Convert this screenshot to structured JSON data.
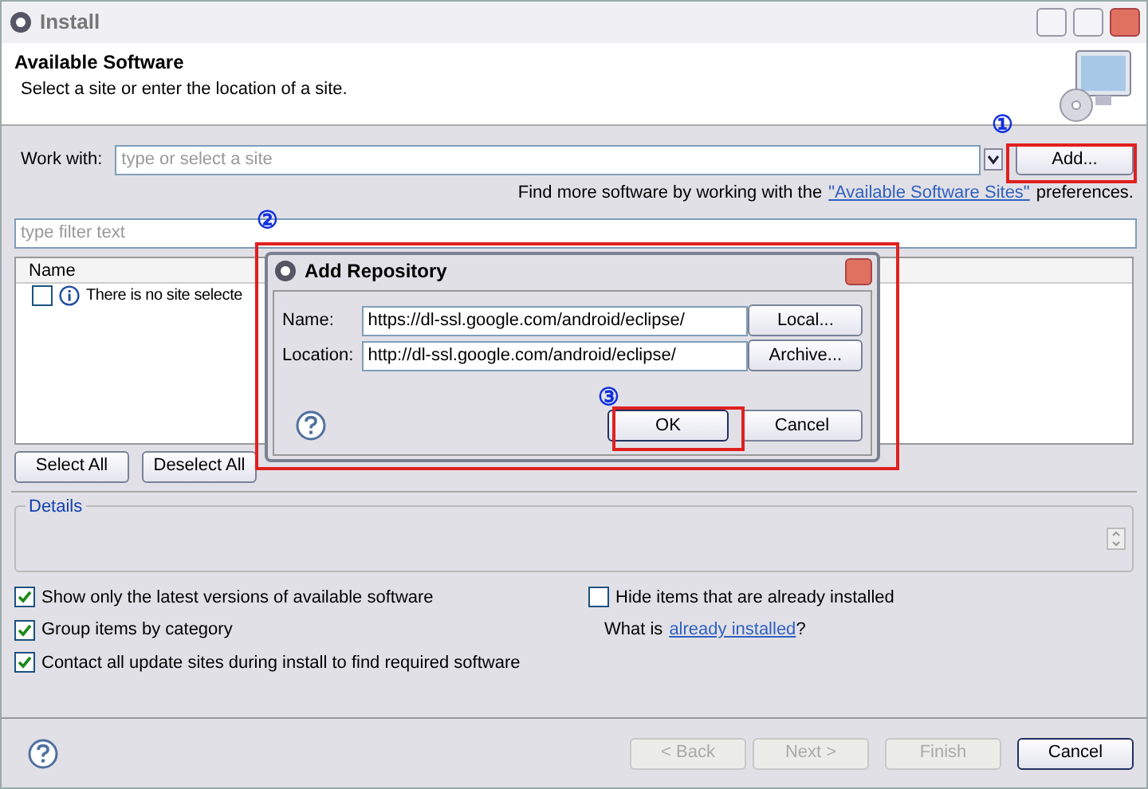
{
  "window": {
    "title": "Install"
  },
  "header": {
    "title": "Available Software",
    "description": "Select a site or enter the location of a site."
  },
  "work_with": {
    "label": "Work with:",
    "placeholder": "type or select a site",
    "add_button": "Add..."
  },
  "more_software": {
    "text": "Find more software by working with the",
    "link": "\"Available Software Sites\"",
    "suffix": "preferences."
  },
  "filter": {
    "placeholder": "type filter text"
  },
  "tree": {
    "columns": [
      "Name"
    ],
    "rows": [
      {
        "text": "There is no site selecte",
        "checked": false
      }
    ]
  },
  "selection_buttons": [
    "Select All",
    "Deselect All"
  ],
  "details": {
    "title": "Details"
  },
  "options": [
    {
      "label": "Show only the latest versions of available software",
      "checked": true
    },
    {
      "label": "Group items by category",
      "checked": true
    },
    {
      "label": "Contact all update sites during install to find required software",
      "checked": true
    }
  ],
  "hide_installed": {
    "label": "Hide items that are already installed",
    "checked": false
  },
  "what_is": {
    "text": "What is",
    "link": "already installed",
    "suffix": "?"
  },
  "footer_buttons": [
    {
      "label": "< Back",
      "disabled": true
    },
    {
      "label": "Next >",
      "disabled": true
    },
    {
      "label": "Finish",
      "disabled": true
    },
    {
      "label": "Cancel",
      "disabled": false
    }
  ],
  "dialog": {
    "title": "Add Repository",
    "fields": [
      {
        "label": "Name:",
        "value": "https://dl-ssl.google.com/android/eclipse/",
        "button": "Local..."
      },
      {
        "label": "Location:",
        "value": "http://dl-ssl.google.com/android/eclipse/",
        "button": "Archive..."
      }
    ],
    "buttons": [
      "OK",
      "Cancel"
    ]
  },
  "annotations": [
    "①",
    "②",
    "③"
  ]
}
